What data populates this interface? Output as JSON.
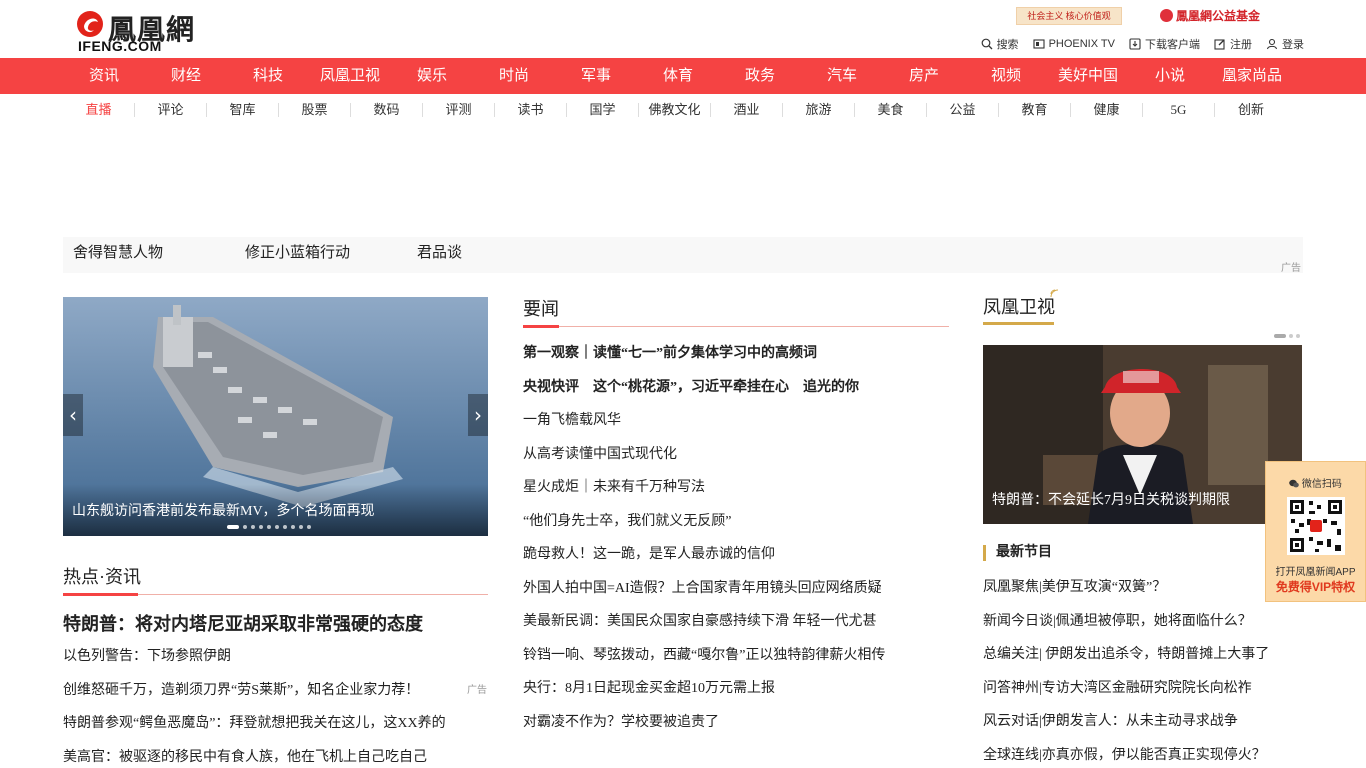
{
  "logo": {
    "cn": "鳳凰網",
    "en": "IFENG.COM"
  },
  "promo_banner": "社会主义 核心价值观",
  "charity": "鳳凰網公益基金",
  "toolbar": [
    {
      "label": "搜索",
      "icon": "search-icon"
    },
    {
      "label": "PHOENIX TV",
      "icon": "tv-icon"
    },
    {
      "label": "下载客户端",
      "icon": "download-icon"
    },
    {
      "label": "注册",
      "icon": "edit-icon"
    },
    {
      "label": "登录",
      "icon": "user-icon"
    }
  ],
  "nav": [
    "资讯",
    "财经",
    "科技",
    "凤凰卫视",
    "娱乐",
    "时尚",
    "军事",
    "体育",
    "政务",
    "汽车",
    "房产",
    "视频",
    "美好中国",
    "小说",
    "凰家尚品"
  ],
  "subnav": [
    "直播",
    "评论",
    "智库",
    "股票",
    "数码",
    "评测",
    "读书",
    "国学",
    "佛教文化",
    "酒业",
    "旅游",
    "美食",
    "公益",
    "教育",
    "健康",
    "5G",
    "创新"
  ],
  "adstrip": {
    "links": [
      "舍得智慧人物",
      "修正小蓝箱行动",
      "君品谈"
    ],
    "tag": "广告"
  },
  "carousel": {
    "caption": "山东舰访问香港前发布最新MV，多个名场面再现",
    "slides": 10,
    "active": 0
  },
  "hot": {
    "title": "热点·资讯",
    "headline": "特朗普：将对内塔尼亚胡采取非常强硬的态度",
    "items": [
      {
        "text": "以色列警告：下场参照伊朗"
      },
      {
        "text": "创维怒砸千万，造剃须刀界“劳S莱斯”，知名企业家力荐！",
        "ad": "广告"
      },
      {
        "text": "特朗普参观“鳄鱼恶魔岛”：拜登就想把我关在这儿，这XX养的"
      },
      {
        "text": "美高官：被驱逐的移民中有食人族，他在飞机上自己吃自己"
      }
    ]
  },
  "news": {
    "title": "要闻",
    "items": [
      {
        "text": "第一观察｜读懂“七一”前夕集体学习中的高频词",
        "bold": true
      },
      {
        "text": "央视快评　这个“桃花源”，习近平牵挂在心　追光的你",
        "bold": true
      },
      {
        "text": "一角飞檐载风华"
      },
      {
        "text": "从高考读懂中国式现代化"
      },
      {
        "text": "星火成炬｜未来有千万种写法"
      },
      {
        "text": "“他们身先士卒，我们就义无反顾”"
      },
      {
        "text": "跪母救人！这一跪，是军人最赤诚的信仰"
      },
      {
        "text": "外国人拍中国=AI造假？上合国家青年用镜头回应网络质疑"
      },
      {
        "text": "美最新民调：美国民众国家自豪感持续下滑 年轻一代尤甚"
      },
      {
        "text": "铃铛一响、琴弦拨动，西藏“嘎尔鲁”正以独特韵律薪火相传"
      },
      {
        "text": "央行：8月1日起现金买金超10万元需上报"
      },
      {
        "text": "对霸凌不作为？学校要被追责了"
      }
    ]
  },
  "phoenix_tv": {
    "title": "凤凰卫视",
    "video_caption": "特朗普：不会延长7月9日关税谈判期限",
    "latest_label": "最新节目",
    "items": [
      "凤凰聚焦|美伊互攻演“双簧”？",
      "新闻今日谈|佩通坦被停职，她将面临什么？",
      "总编关注| 伊朗发出追杀令，特朗普摊上大事了",
      "问答神州|专访大湾区金融研究院院长向松祚",
      "风云对话|伊朗发言人：从未主动寻求战争",
      "全球连线|亦真亦假，伊以能否真正实现停火？"
    ]
  },
  "qr": {
    "title": "微信扫码",
    "line1": "打开凤凰新闻APP",
    "line2": "免费得VIP特权"
  },
  "colors": {
    "nav_red": "#f54343",
    "gold": "#d4a94a"
  }
}
